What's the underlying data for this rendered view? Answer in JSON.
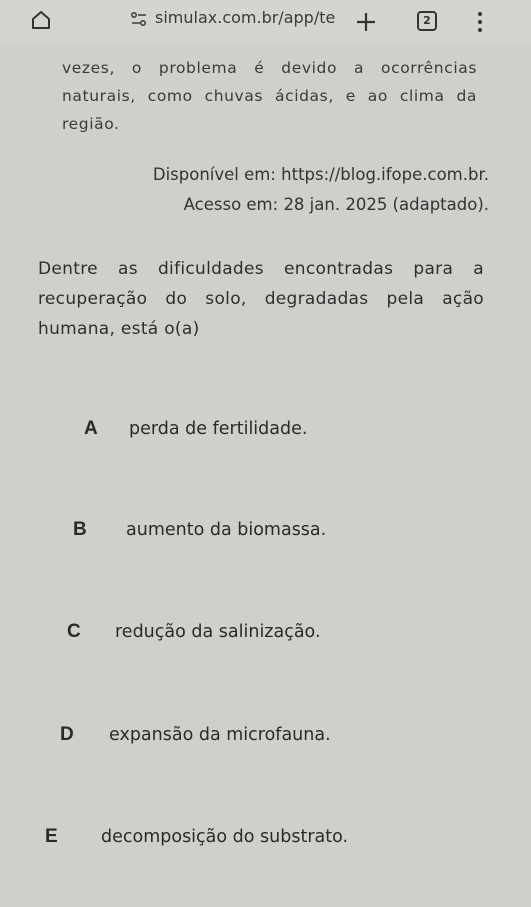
{
  "browser": {
    "url": "simulax.com.br/app/te",
    "tab_count": "2"
  },
  "passage": {
    "text": "vezes, o problema é devido a ocorrências naturais, como chuvas ácidas, e ao clima da região."
  },
  "source": {
    "available": "Disponível em: https://blog.ifope.com.br.",
    "accessed": "Acesso em: 28 jan. 2025 (adaptado)."
  },
  "question": {
    "text": "Dentre as dificuldades encontradas para a recuperação do solo, degradadas pela ação humana, está o(a)"
  },
  "options": [
    {
      "letter": "A",
      "text": "perda de fertilidade."
    },
    {
      "letter": "B",
      "text": "aumento da biomassa."
    },
    {
      "letter": "C",
      "text": "redução da salinização."
    },
    {
      "letter": "D",
      "text": "expansão da microfauna."
    },
    {
      "letter": "E",
      "text": "decomposição do substrato."
    }
  ],
  "icons": {
    "home": "home-icon",
    "site": "site-settings-icon",
    "new_tab": "plus-icon",
    "tabs": "tab-switcher-icon",
    "menu": "more-vert-icon"
  }
}
